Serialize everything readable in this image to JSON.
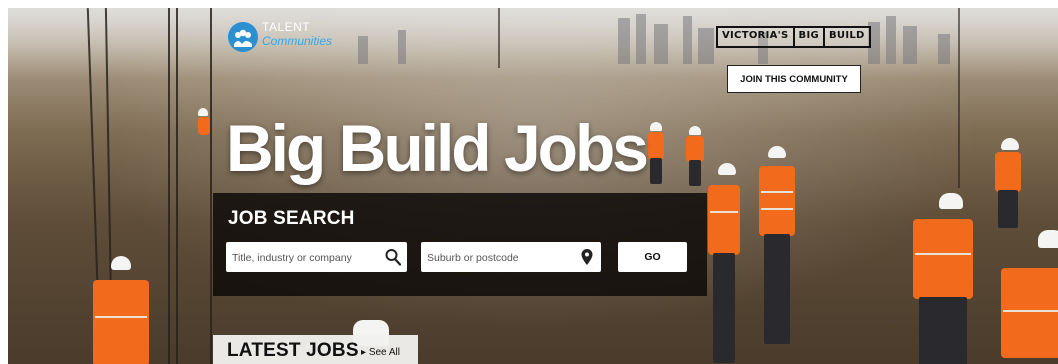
{
  "brand": {
    "logo_line1": "TALENT",
    "logo_line2": "Communities",
    "partner_words": [
      "VICTORIA'S",
      "BIG",
      "BUILD"
    ]
  },
  "header": {
    "join_button": "JOIN THIS COMMUNITY"
  },
  "hero": {
    "title": "Big Build Jobs"
  },
  "search": {
    "label": "JOB SEARCH",
    "keyword_placeholder": "Title, industry or company",
    "location_placeholder": "Suburb or postcode",
    "go_label": "GO"
  },
  "latest_jobs": {
    "title": "LATEST JOBS",
    "see_all": "See All"
  },
  "colors": {
    "accent_blue": "#2b8fd0",
    "hivis_orange": "#f26a1b",
    "panel_dark": "#0f0c0a"
  }
}
